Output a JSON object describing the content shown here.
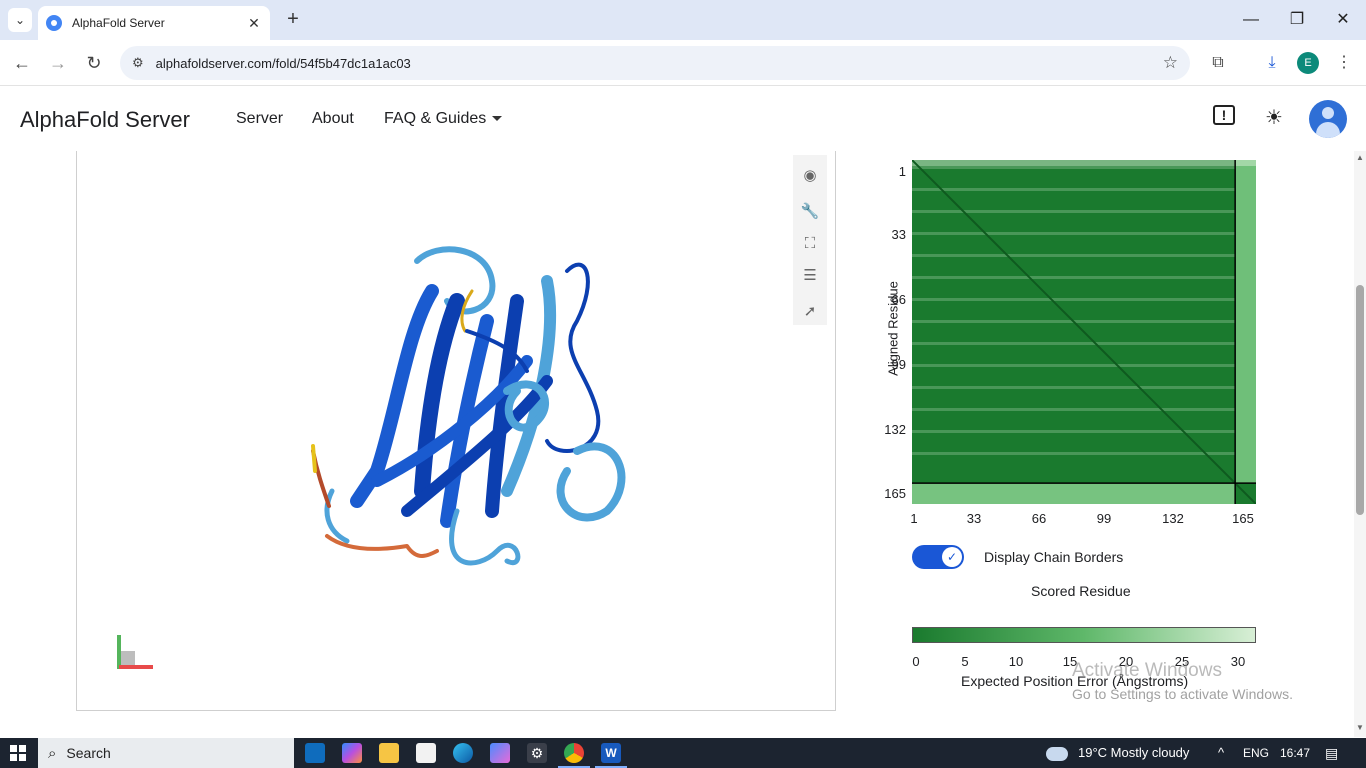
{
  "browser": {
    "tab_title": "AlphaFold Server",
    "url": "alphafoldserver.com/fold/54f5b47dc1a1ac03",
    "profile_initial": "E",
    "glyphs": {
      "tab_menu": "⌄",
      "tab_close": "✕",
      "new_tab": "+",
      "minimize": "—",
      "maximize": "❐",
      "close": "✕",
      "back": "←",
      "forward": "→",
      "reload": "↻",
      "site_info": "⚙",
      "bookmark": "☆",
      "extensions": "⧉",
      "download": "⤓",
      "menu": "⋮"
    }
  },
  "header": {
    "brand": "AlphaFold Server",
    "nav": [
      "Server",
      "About",
      "FAQ & Guides"
    ],
    "icons": [
      "feedback-icon",
      "theme-sun-icon",
      "avatar"
    ],
    "glyphs": {
      "feedback": "!",
      "theme": "☀"
    }
  },
  "viewer": {
    "tools": [
      "camera-aperture-icon",
      "wrench-icon",
      "fullscreen-icon",
      "sliders-icon",
      "cursor-icon"
    ],
    "tool_glyphs": [
      "◉",
      "🔧",
      "⛶",
      "☰",
      "➚"
    ]
  },
  "pae_plot": {
    "y_axis_label": "Aligned Residue",
    "x_axis_label": "Scored Residue",
    "y_ticks": [
      "1",
      "33",
      "66",
      "99",
      "132",
      "165"
    ],
    "x_ticks": [
      "1",
      "33",
      "66",
      "99",
      "132",
      "165"
    ],
    "chain_break_residue": 155,
    "colors": {
      "low_error": "#1a7a2e",
      "mid_error": "#5fb86a",
      "high_error": "#d8efd6"
    }
  },
  "chain_borders": {
    "label": "Display Chain Borders",
    "enabled": true,
    "check_glyph": "✓"
  },
  "colorbar": {
    "ticks": [
      "0",
      "5",
      "10",
      "15",
      "20",
      "25",
      "30"
    ],
    "title": "Expected Position Error (Ångstroms)"
  },
  "watermark": {
    "line1": "Activate Windows",
    "line2": "Go to Settings to activate Windows."
  },
  "taskbar": {
    "search_placeholder": "Search",
    "search_glyph": "⌕",
    "weather": "19°C  Mostly cloudy",
    "language": "ENG",
    "time": "16:47",
    "tray_glyphs": {
      "chevron": "^",
      "notifications": "▤"
    },
    "apps": [
      "outlook-icon",
      "copilot-icon",
      "file-explorer-icon",
      "store-icon",
      "edge-icon",
      "gemini-icon",
      "settings-icon",
      "chrome-icon",
      "word-icon"
    ]
  }
}
